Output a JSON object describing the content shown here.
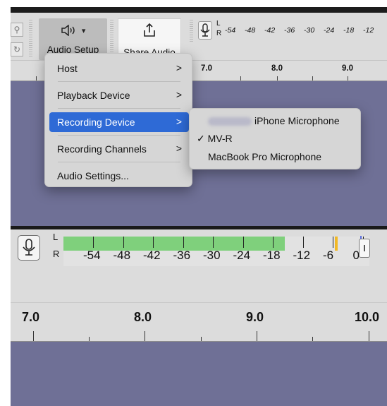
{
  "toolbar": {
    "audio_setup_icon": "speaker-icon",
    "audio_setup_label": "Audio Setup",
    "audio_setup_caret": "▾",
    "share_audio_label": "Share Audio",
    "share_icon": "share-icon"
  },
  "top_meter": {
    "L": "L",
    "R": "R",
    "ticks": [
      "-54",
      "-48",
      "-42",
      "-36",
      "-30",
      "-24",
      "-18",
      "-12"
    ]
  },
  "top_ruler": {
    "labels": [
      "7.0",
      "8.0",
      "9.0"
    ]
  },
  "menu": {
    "items": [
      {
        "label": "Host",
        "chevron": ">",
        "selected": false
      },
      {
        "label": "Playback Device",
        "chevron": ">",
        "selected": false
      },
      {
        "label": "Recording Device",
        "chevron": ">",
        "selected": true
      },
      {
        "label": "Recording Channels",
        "chevron": ">",
        "selected": false
      },
      {
        "label": "Audio Settings...",
        "chevron": "",
        "selected": false
      }
    ]
  },
  "submenu": {
    "items": [
      {
        "label": "iPhone Microphone",
        "checked": false,
        "redacted_prefix": true
      },
      {
        "label": "MV-R",
        "checked": true
      },
      {
        "label": "MacBook Pro Microphone",
        "checked": false
      }
    ],
    "check_mark": "✓"
  },
  "meter": {
    "L": "L",
    "R": "R",
    "ticks": [
      "-54",
      "-48",
      "-42",
      "-36",
      "-30",
      "-24",
      "-18",
      "-12",
      "-6",
      "0"
    ],
    "level_db": -15,
    "peak_db": -5
  },
  "bottom_ruler": {
    "labels": [
      "7.0",
      "8.0",
      "9.0",
      "10.0"
    ]
  }
}
